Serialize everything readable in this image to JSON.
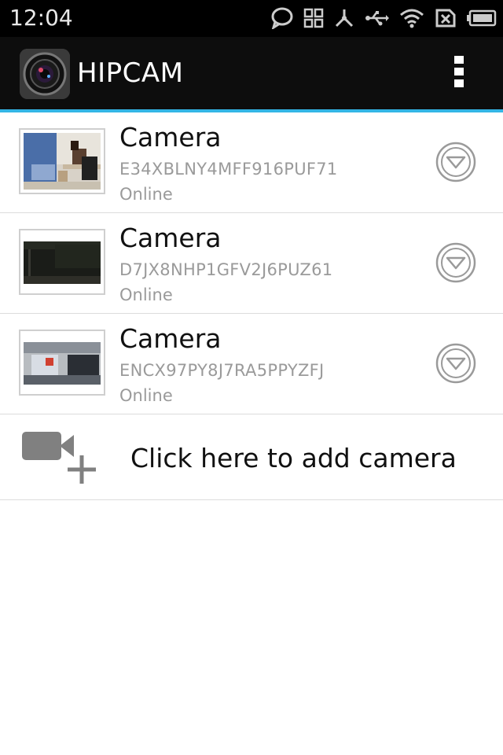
{
  "status_bar": {
    "time": "12:04",
    "icons": [
      "chat-bubble-icon",
      "grid-icon",
      "bluetooth-share-icon",
      "usb-icon",
      "wifi-icon",
      "sim-icon",
      "battery-icon"
    ]
  },
  "action_bar": {
    "title": "HIPCAM",
    "accent_color": "#33b5e5",
    "overflow_icon": "overflow-menu-icon"
  },
  "cameras": [
    {
      "name": "Camera",
      "id": "E34XBLNY4MFF916PUF71",
      "status": "Online",
      "thumbnail": "office-snapshot"
    },
    {
      "name": "Camera",
      "id": "D7JX8NHP1GFV2J6PUZ61",
      "status": "Online",
      "thumbnail": "dark-room-snapshot"
    },
    {
      "name": "Camera",
      "id": "ENCX97PY8J7RA5PPYZFJ",
      "status": "Online",
      "thumbnail": "desk-monitor-snapshot"
    }
  ],
  "add_camera": {
    "label": "Click here to add camera",
    "icon": "add-video-camera-icon"
  }
}
